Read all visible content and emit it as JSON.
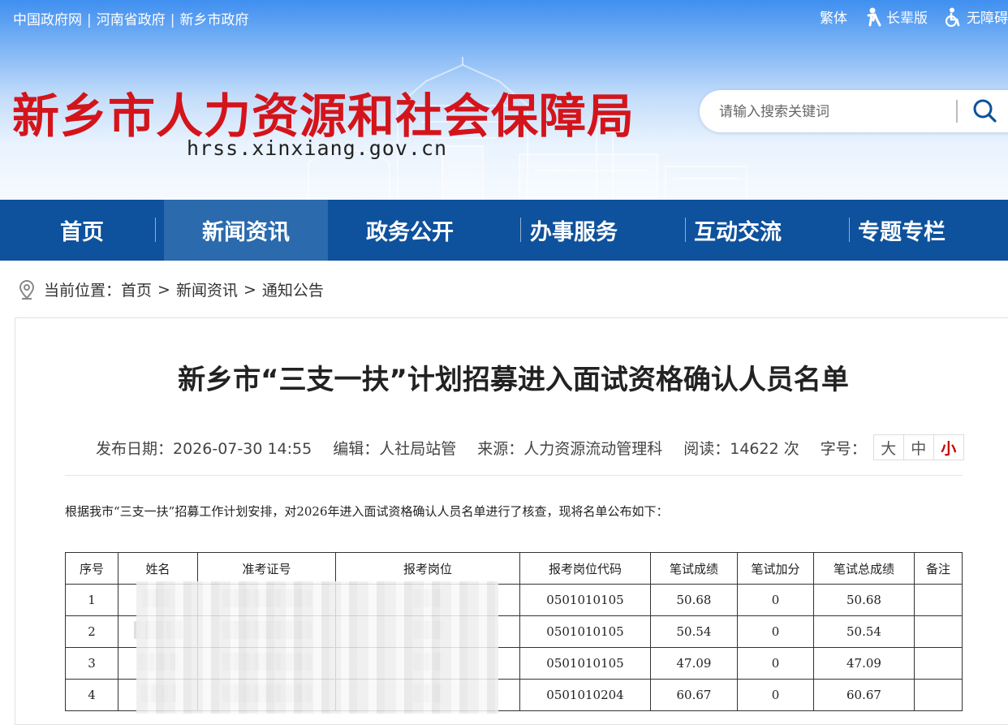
{
  "top_links": [
    "中国政府网",
    "河南省政府",
    "新乡市政府"
  ],
  "top_right": {
    "traditional": "繁体",
    "elder": "长辈版",
    "accessible": "无障碍"
  },
  "site": {
    "title": "新乡市人力资源和社会保障局",
    "domain": "hrss.xinxiang.gov.cn"
  },
  "search": {
    "placeholder": "请输入搜索关键词"
  },
  "nav": [
    "首页",
    "新闻资讯",
    "政务公开",
    "办事服务",
    "互动交流",
    "专题专栏"
  ],
  "nav_active": "新闻资讯",
  "breadcrumb": {
    "label": "当前位置：",
    "items": [
      "首页",
      "新闻资讯",
      "通知公告"
    ],
    "separator": ">"
  },
  "article": {
    "title": "新乡市“三支一扶”计划招募进入面试资格确认人员名单",
    "meta": {
      "date": "发布日期：2026-07-30 14:55",
      "editor": "编辑：人社局站管",
      "source": "来源：人力资源流动管理科",
      "reads": "阅读：14622 次",
      "font_label": "字号：",
      "font_sizes": [
        "大",
        "中",
        "小"
      ]
    },
    "intro": "根据我市“三支一扶”招募工作计划安排，对2026年进入面试资格确认人员名单进行了核查，现将名单公布如下：",
    "table": {
      "headers": [
        "序号",
        "姓名",
        "准考证号",
        "报考岗位",
        "报考岗位代码",
        "笔试成绩",
        "笔试加分",
        "笔试总成绩",
        "备注"
      ],
      "rows": [
        {
          "no": "1",
          "code": "0501010105",
          "score": "50.68",
          "bonus": "0",
          "total": "50.68",
          "note": ""
        },
        {
          "no": "2",
          "code": "0501010105",
          "score": "50.54",
          "bonus": "0",
          "total": "50.54",
          "note": ""
        },
        {
          "no": "3",
          "code": "0501010105",
          "score": "47.09",
          "bonus": "0",
          "total": "47.09",
          "note": ""
        },
        {
          "no": "4",
          "code": "0501010204",
          "score": "60.67",
          "bonus": "0",
          "total": "60.67",
          "note": ""
        }
      ]
    }
  },
  "colors": {
    "title_red": "#d4141b",
    "nav_blue": "#0e519c",
    "nav_active": "#2a6aad"
  }
}
